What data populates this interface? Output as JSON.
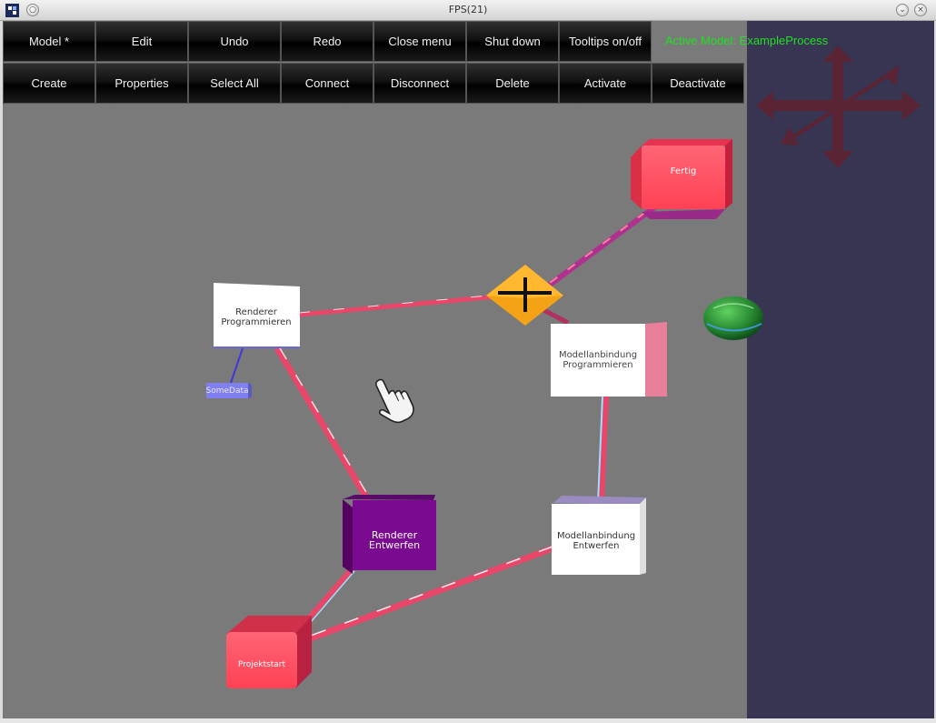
{
  "window": {
    "title": "FPS(21)"
  },
  "menu": {
    "row1": [
      "Model *",
      "Edit",
      "Undo",
      "Redo",
      "Close menu",
      "Shut down",
      "Tooltips on/off"
    ],
    "row2": [
      "Create",
      "Properties",
      "Select All",
      "Connect",
      "Disconnect",
      "Delete",
      "Activate",
      "Deactivate"
    ]
  },
  "status": {
    "active_model": "Active Model: ExampleProcess"
  },
  "nodes": {
    "fertig": "Fertig",
    "renderer_programmieren_1": "Renderer",
    "renderer_programmieren_2": "Programmieren",
    "somedata": "SomeData",
    "modellanbindung_programmieren_1": "Modellanbindung",
    "modellanbindung_programmieren_2": "Programmieren",
    "renderer_entwerfen_1": "Renderer",
    "renderer_entwerfen_2": "Entwerfen",
    "modellanbindung_entwerfen_1": "Modellanbindung",
    "modellanbindung_entwerfen_2": "Entwerfen",
    "projektstart": "Projektstart"
  },
  "colors": {
    "canvas": "#7a7a7a",
    "side_panel": "#373552",
    "active_model_text": "#22e022",
    "start_end_node": "#ff4d62",
    "activity_node": "#ffffff",
    "selected_node": "#7a0a90",
    "gateway": "#f5a316",
    "data_object": "#7f7ff2",
    "edge": "#e8476a",
    "nav_arrows": "#5a2434"
  },
  "icons": {
    "navigation": "four-way-arrows-icon",
    "cursor": "hand-pointer-icon",
    "globe": "green-sphere-icon",
    "gateway_marker": "crosshair-icon"
  }
}
